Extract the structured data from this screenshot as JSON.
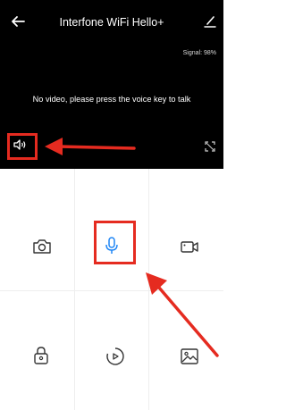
{
  "header": {
    "title": "Interfone WiFi Hello+",
    "back_icon": "arrow-left-icon",
    "edit_icon": "pencil-icon"
  },
  "video": {
    "signal_text": "Signal: 98%",
    "message": "No video, please press the voice key to talk",
    "speaker_icon": "speaker-icon",
    "fullscreen_icon": "expand-icon"
  },
  "controls": [
    {
      "name": "snapshot",
      "icon": "camera-icon"
    },
    {
      "name": "talk",
      "icon": "microphone-icon",
      "active": true
    },
    {
      "name": "record",
      "icon": "video-camera-icon"
    },
    {
      "name": "unlock",
      "icon": "padlock-icon"
    },
    {
      "name": "playback",
      "icon": "playback-icon"
    },
    {
      "name": "gallery",
      "icon": "image-icon"
    }
  ],
  "colors": {
    "background_dark": "#000000",
    "background_light": "#ffffff",
    "accent": "#1f86f5",
    "annotation": "#e52b20"
  }
}
